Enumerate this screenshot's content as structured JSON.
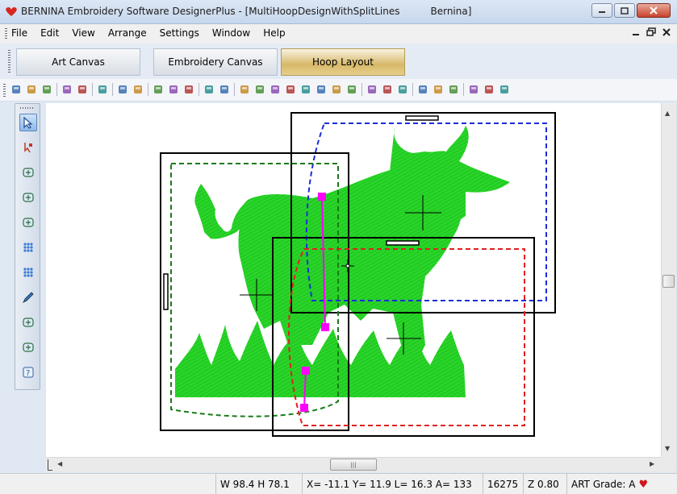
{
  "window": {
    "title": "BERNINA Embroidery Software DesignerPlus - [MultiHoopDesignWithSplitLines",
    "title_suffix": "Bernina]",
    "icon": "bernina-logo-icon"
  },
  "menu": {
    "items": [
      {
        "label": "File"
      },
      {
        "label": "Edit"
      },
      {
        "label": "View"
      },
      {
        "label": "Arrange"
      },
      {
        "label": "Settings"
      },
      {
        "label": "Window"
      },
      {
        "label": "Help"
      }
    ]
  },
  "tabs": [
    {
      "label": "Art Canvas",
      "active": false
    },
    {
      "label": "Embroidery Canvas",
      "active": false
    },
    {
      "label": "Hoop Layout",
      "active": true
    }
  ],
  "toolbar": {
    "icons": [
      "new-icon",
      "open-icon",
      "save-icon",
      "|",
      "print-icon",
      "print-preview-icon",
      "|",
      "web-icon",
      "|",
      "import-icon",
      "export-icon",
      "|",
      "cut-icon",
      "copy-icon",
      "paste-icon",
      "|",
      "undo-icon",
      "redo-icon",
      "|",
      "grid-icon",
      "hoop-icon",
      "stitch-icon",
      "color-icon",
      "appliqué-icon",
      "redwork-icon",
      "trace-icon",
      "lattice-icon",
      "|",
      "align-icon",
      "distribute-icon",
      "arrange-icon",
      "|",
      "overview-icon",
      "user-icon",
      "settings-icon",
      "|",
      "zoom-in-icon",
      "zoom-out-icon",
      "zoom-fit-icon"
    ]
  },
  "left_tools": [
    {
      "icon": "select-pointer-icon",
      "selected": true
    },
    {
      "icon": "reshape-icon",
      "selected": false
    },
    {
      "icon": "add-hoop-icon",
      "selected": false
    },
    {
      "icon": "hoop-icon",
      "selected": false
    },
    {
      "icon": "hoop-center-icon",
      "selected": false
    },
    {
      "icon": "split-line-icon",
      "selected": false
    },
    {
      "icon": "grid-split-icon",
      "selected": false
    },
    {
      "icon": "pen-icon",
      "selected": false
    },
    {
      "icon": "delete-hoop-icon",
      "selected": false
    },
    {
      "icon": "hoop-outline-icon",
      "selected": false
    },
    {
      "icon": "help-icon",
      "selected": false
    }
  ],
  "status": {
    "size": "W 98.4 H 78.1",
    "coords": "X= -11.1 Y=  11.9 L=  16.3 A= 133",
    "stitches": "16275",
    "zoom": "Z 0.80",
    "art_grade": "ART Grade: A"
  },
  "colors": {
    "embroidery_green": "#22cc22",
    "split_line": "#ff00ff",
    "hoop_blue": "#1a2fd8",
    "hoop_red": "#e02020",
    "hoop_green": "#1a7a1a"
  }
}
